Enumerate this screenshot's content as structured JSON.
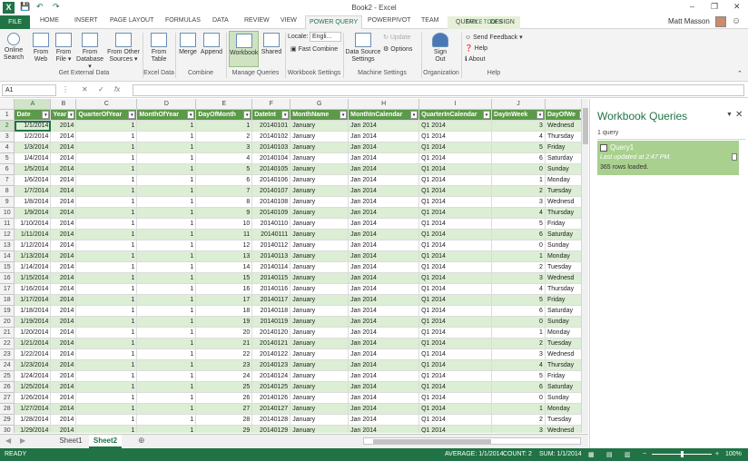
{
  "window": {
    "title": "Book2 - Excel",
    "minimize": "–",
    "restore": "❐",
    "close": "✕"
  },
  "quick_access": {
    "save": "💾",
    "undo": "↶",
    "redo": "↷"
  },
  "tabs": [
    "FILE",
    "HOME",
    "INSERT",
    "PAGE LAYOUT",
    "FORMULAS",
    "DATA",
    "REVIEW",
    "VIEW",
    "POWER QUERY",
    "POWERPIVOT",
    "TEAM",
    "QUERY",
    "DESIGN"
  ],
  "active_tab": "POWER QUERY",
  "context_group": "TABLE TOOLS",
  "user": {
    "name": "Matt Masson"
  },
  "ribbon": {
    "online_search": "Online Search",
    "from_web": "From Web",
    "from_file": "From File ▾",
    "from_database": "From Database ▾",
    "from_other": "From Other Sources ▾",
    "from_table": "From Table",
    "merge": "Merge",
    "append": "Append",
    "workbook": "Workbook",
    "shared": "Shared",
    "locale_label": "Locale:",
    "locale_value": "Engli...",
    "fast_combine": "Fast Combine",
    "data_source_settings": "Data Source Settings",
    "update": "Update",
    "options": "Options",
    "sign_out": "Sign Out",
    "send_feedback": "Send Feedback ▾",
    "help": "Help",
    "about": "About",
    "groups": [
      "Get External Data",
      "Excel Data",
      "Combine",
      "Manage Queries",
      "Workbook Settings",
      "Machine Settings",
      "Organization",
      "Help"
    ]
  },
  "formula_bar": {
    "name_box": "A1",
    "cancel": "✕",
    "enter": "✓",
    "fx": "fx",
    "formula": ""
  },
  "columns": [
    "A",
    "B",
    "C",
    "D",
    "E",
    "F",
    "G",
    "H",
    "I",
    "J",
    ""
  ],
  "table": {
    "headers": [
      "Date",
      "Year",
      "QuarterOfYear",
      "MonthOfYear",
      "DayOfMonth",
      "DateInt",
      "MonthName",
      "MonthInCalendar",
      "QuarterInCalendar",
      "DayInWeek",
      "DayOfWe"
    ],
    "rows": [
      [
        "1/1/2014",
        "2014",
        "1",
        "1",
        "1",
        "20140101",
        "January",
        "Jan 2014",
        "Q1 2014",
        "3",
        "Wednesd"
      ],
      [
        "1/2/2014",
        "2014",
        "1",
        "1",
        "2",
        "20140102",
        "January",
        "Jan 2014",
        "Q1 2014",
        "4",
        "Thursday"
      ],
      [
        "1/3/2014",
        "2014",
        "1",
        "1",
        "3",
        "20140103",
        "January",
        "Jan 2014",
        "Q1 2014",
        "5",
        "Friday"
      ],
      [
        "1/4/2014",
        "2014",
        "1",
        "1",
        "4",
        "20140104",
        "January",
        "Jan 2014",
        "Q1 2014",
        "6",
        "Saturday"
      ],
      [
        "1/5/2014",
        "2014",
        "1",
        "1",
        "5",
        "20140105",
        "January",
        "Jan 2014",
        "Q1 2014",
        "0",
        "Sunday"
      ],
      [
        "1/6/2014",
        "2014",
        "1",
        "1",
        "6",
        "20140106",
        "January",
        "Jan 2014",
        "Q1 2014",
        "1",
        "Monday"
      ],
      [
        "1/7/2014",
        "2014",
        "1",
        "1",
        "7",
        "20140107",
        "January",
        "Jan 2014",
        "Q1 2014",
        "2",
        "Tuesday"
      ],
      [
        "1/8/2014",
        "2014",
        "1",
        "1",
        "8",
        "20140108",
        "January",
        "Jan 2014",
        "Q1 2014",
        "3",
        "Wednesd"
      ],
      [
        "1/9/2014",
        "2014",
        "1",
        "1",
        "9",
        "20140109",
        "January",
        "Jan 2014",
        "Q1 2014",
        "4",
        "Thursday"
      ],
      [
        "1/10/2014",
        "2014",
        "1",
        "1",
        "10",
        "20140110",
        "January",
        "Jan 2014",
        "Q1 2014",
        "5",
        "Friday"
      ],
      [
        "1/11/2014",
        "2014",
        "1",
        "1",
        "11",
        "20140111",
        "January",
        "Jan 2014",
        "Q1 2014",
        "6",
        "Saturday"
      ],
      [
        "1/12/2014",
        "2014",
        "1",
        "1",
        "12",
        "20140112",
        "January",
        "Jan 2014",
        "Q1 2014",
        "0",
        "Sunday"
      ],
      [
        "1/13/2014",
        "2014",
        "1",
        "1",
        "13",
        "20140113",
        "January",
        "Jan 2014",
        "Q1 2014",
        "1",
        "Monday"
      ],
      [
        "1/14/2014",
        "2014",
        "1",
        "1",
        "14",
        "20140114",
        "January",
        "Jan 2014",
        "Q1 2014",
        "2",
        "Tuesday"
      ],
      [
        "1/15/2014",
        "2014",
        "1",
        "1",
        "15",
        "20140115",
        "January",
        "Jan 2014",
        "Q1 2014",
        "3",
        "Wednesd"
      ],
      [
        "1/16/2014",
        "2014",
        "1",
        "1",
        "16",
        "20140116",
        "January",
        "Jan 2014",
        "Q1 2014",
        "4",
        "Thursday"
      ],
      [
        "1/17/2014",
        "2014",
        "1",
        "1",
        "17",
        "20140117",
        "January",
        "Jan 2014",
        "Q1 2014",
        "5",
        "Friday"
      ],
      [
        "1/18/2014",
        "2014",
        "1",
        "1",
        "18",
        "20140118",
        "January",
        "Jan 2014",
        "Q1 2014",
        "6",
        "Saturday"
      ],
      [
        "1/19/2014",
        "2014",
        "1",
        "1",
        "19",
        "20140119",
        "January",
        "Jan 2014",
        "Q1 2014",
        "0",
        "Sunday"
      ],
      [
        "1/20/2014",
        "2014",
        "1",
        "1",
        "20",
        "20140120",
        "January",
        "Jan 2014",
        "Q1 2014",
        "1",
        "Monday"
      ],
      [
        "1/21/2014",
        "2014",
        "1",
        "1",
        "21",
        "20140121",
        "January",
        "Jan 2014",
        "Q1 2014",
        "2",
        "Tuesday"
      ],
      [
        "1/22/2014",
        "2014",
        "1",
        "1",
        "22",
        "20140122",
        "January",
        "Jan 2014",
        "Q1 2014",
        "3",
        "Wednesd"
      ],
      [
        "1/23/2014",
        "2014",
        "1",
        "1",
        "23",
        "20140123",
        "January",
        "Jan 2014",
        "Q1 2014",
        "4",
        "Thursday"
      ],
      [
        "1/24/2014",
        "2014",
        "1",
        "1",
        "24",
        "20140124",
        "January",
        "Jan 2014",
        "Q1 2014",
        "5",
        "Friday"
      ],
      [
        "1/25/2014",
        "2014",
        "1",
        "1",
        "25",
        "20140125",
        "January",
        "Jan 2014",
        "Q1 2014",
        "6",
        "Saturday"
      ],
      [
        "1/26/2014",
        "2014",
        "1",
        "1",
        "26",
        "20140126",
        "January",
        "Jan 2014",
        "Q1 2014",
        "0",
        "Sunday"
      ],
      [
        "1/27/2014",
        "2014",
        "1",
        "1",
        "27",
        "20140127",
        "January",
        "Jan 2014",
        "Q1 2014",
        "1",
        "Monday"
      ],
      [
        "1/28/2014",
        "2014",
        "1",
        "1",
        "28",
        "20140128",
        "January",
        "Jan 2014",
        "Q1 2014",
        "2",
        "Tuesday"
      ],
      [
        "1/29/2014",
        "2014",
        "1",
        "1",
        "29",
        "20140129",
        "January",
        "Jan 2014",
        "Q1 2014",
        "3",
        "Wednesd"
      ]
    ]
  },
  "sheets": [
    "Sheet1",
    "Sheet2"
  ],
  "active_sheet": "Sheet2",
  "add_sheet": "⊕",
  "pane": {
    "title": "Workbook Queries",
    "count": "1 query",
    "query_name": "Query1",
    "last_updated": "Last updated at 2:47 PM.",
    "rows_loaded": "365 rows loaded."
  },
  "status": {
    "ready": "READY",
    "average": "AVERAGE: 1/1/2014",
    "count": "COUNT: 2",
    "sum": "SUM: 1/1/2014",
    "zoom": "100%"
  },
  "colors": {
    "accent": "#217346",
    "header_fill": "#5b9a48",
    "band_fill": "#dceed4",
    "query_card": "#a9d08e"
  }
}
